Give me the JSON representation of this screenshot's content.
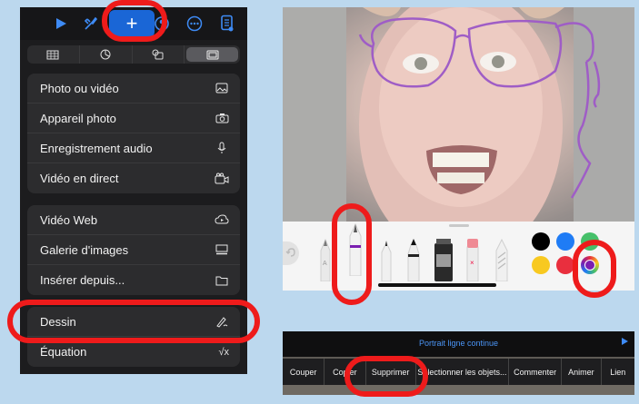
{
  "toolbar": {
    "icons": [
      "play-icon",
      "brush-icon",
      "plus-icon",
      "shapes-icon",
      "more-icon",
      "document-icon"
    ],
    "plus_symbol": "+"
  },
  "tabs": [
    "table-icon",
    "chart-icon",
    "shapes-icon",
    "media-icon"
  ],
  "menu_group_1": [
    {
      "label": "Photo ou vidéo",
      "icon": "photo-icon"
    },
    {
      "label": "Appareil photo",
      "icon": "camera-icon"
    },
    {
      "label": "Enregistrement audio",
      "icon": "microphone-icon"
    },
    {
      "label": "Vidéo en direct",
      "icon": "live-video-icon"
    }
  ],
  "menu_group_2": [
    {
      "label": "Vidéo Web",
      "icon": "web-video-icon"
    },
    {
      "label": "Galerie d'images",
      "icon": "gallery-icon"
    },
    {
      "label": "Insérer depuis...",
      "icon": "folder-icon"
    }
  ],
  "menu_group_3": [
    {
      "label": "Dessin",
      "icon": "pen-icon"
    },
    {
      "label": "Équation",
      "icon": "sqrt-icon",
      "symbol": "√x"
    }
  ],
  "drawing": {
    "tools": [
      "pencil",
      "pen-selected",
      "fineliner",
      "marker",
      "paint",
      "eraser",
      "lasso"
    ],
    "colors": [
      "#000000",
      "#1f7cf5",
      "#46c06a",
      "#f8c920",
      "#e92f3e",
      "#7a1fb0"
    ],
    "selected_color": "#7a1fb0"
  },
  "context_menu": {
    "mode_title": "Portrait ligne continue",
    "items": [
      "Couper",
      "Copier",
      "Supprimer",
      "Sélectionner les objets...",
      "Commenter",
      "Animer",
      "Lien"
    ]
  },
  "colors": {
    "highlight": "#ee1b1b",
    "accent": "#3e8bf5",
    "stroke": "#7a1fb0"
  }
}
